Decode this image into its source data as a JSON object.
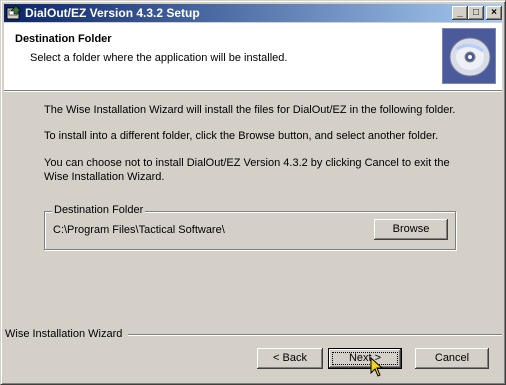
{
  "window": {
    "title": "DialOut/EZ Version 4.3.2 Setup",
    "controls": {
      "minimize": "_",
      "maximize": "□",
      "close": "×"
    }
  },
  "header": {
    "title": "Destination Folder",
    "subtitle": "Select a folder where the application will be installed.",
    "icon": "cd-disc-icon"
  },
  "body": {
    "para1": "The Wise Installation Wizard will install the files for DialOut/EZ in the following folder.",
    "para2": "To install into a different folder, click the Browse button, and select another folder.",
    "para3_line1": "You can choose not to install DialOut/EZ Version 4.3.2 by clicking Cancel to exit the",
    "para3_line2": "Wise Installation Wizard."
  },
  "destination": {
    "group_label": "Destination Folder",
    "path": "C:\\Program Files\\Tactical Software\\",
    "browse_label": "Browse"
  },
  "footer": {
    "brand": "Wise Installation Wizard",
    "back_label": "< Back",
    "next_label": "Next >",
    "cancel_label": "Cancel"
  }
}
